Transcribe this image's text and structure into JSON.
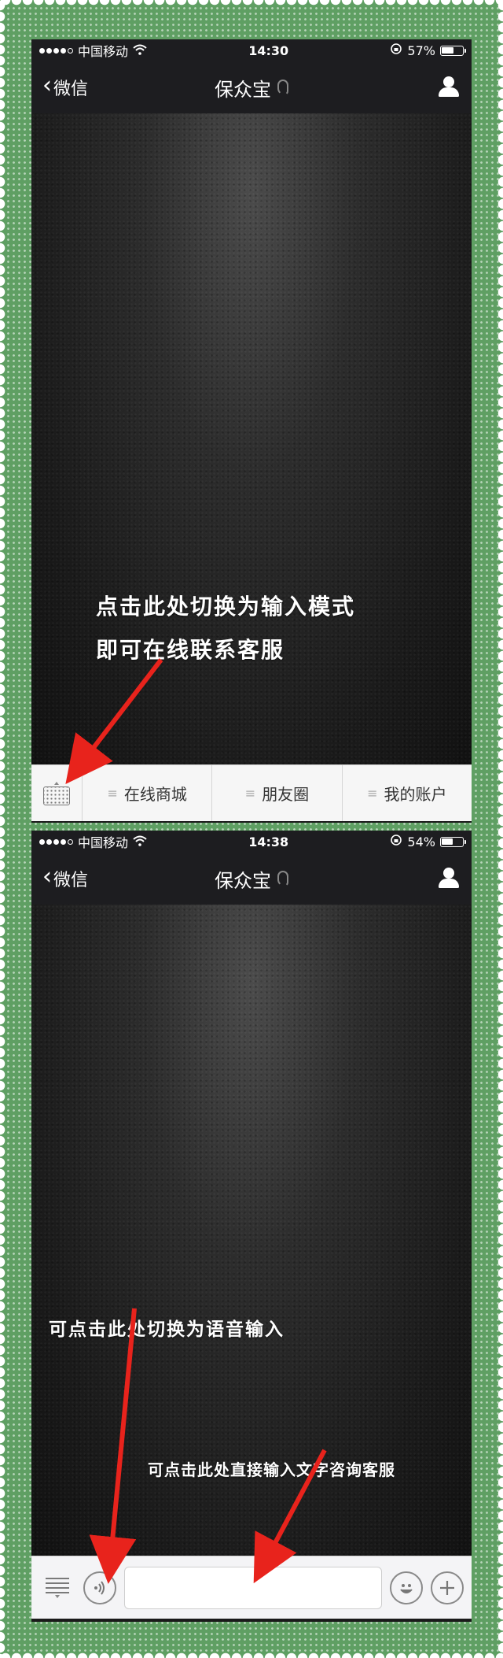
{
  "screen1": {
    "status": {
      "carrier": "中国移动",
      "time": "14:30",
      "battery": "57%",
      "battery_level": 0.57
    },
    "nav": {
      "back_label": "微信",
      "title": "保众宝"
    },
    "overlay": {
      "line1": "点击此处切换为输入模式",
      "line2": "即可在线联系客服"
    },
    "menu": [
      {
        "label": "在线商城"
      },
      {
        "label": "朋友圈"
      },
      {
        "label": "我的账户"
      }
    ]
  },
  "screen2": {
    "status": {
      "carrier": "中国移动",
      "time": "14:38",
      "battery": "54%",
      "battery_level": 0.54
    },
    "nav": {
      "back_label": "微信",
      "title": "保众宝"
    },
    "overlay": {
      "voice_hint": "可点击此处切换为语音输入",
      "text_hint": "可点击此处直接输入文字咨询客服"
    },
    "input": {
      "placeholder": ""
    }
  },
  "icons": {
    "signal": "signal-dots-icon",
    "wifi": "wifi-icon",
    "lock": "rotation-lock-icon",
    "back": "chevron-left-icon",
    "ear": "ear-icon",
    "profile": "person-icon",
    "keyboard": "keyboard-icon",
    "menu": "hamburger-icon",
    "voice": "voice-icon",
    "emoji": "emoji-icon",
    "plus": "plus-icon",
    "list": "list-icon"
  },
  "colors": {
    "frame": "#5f9f63",
    "arrow": "#e8231c",
    "navbar": "#1d1d20"
  }
}
